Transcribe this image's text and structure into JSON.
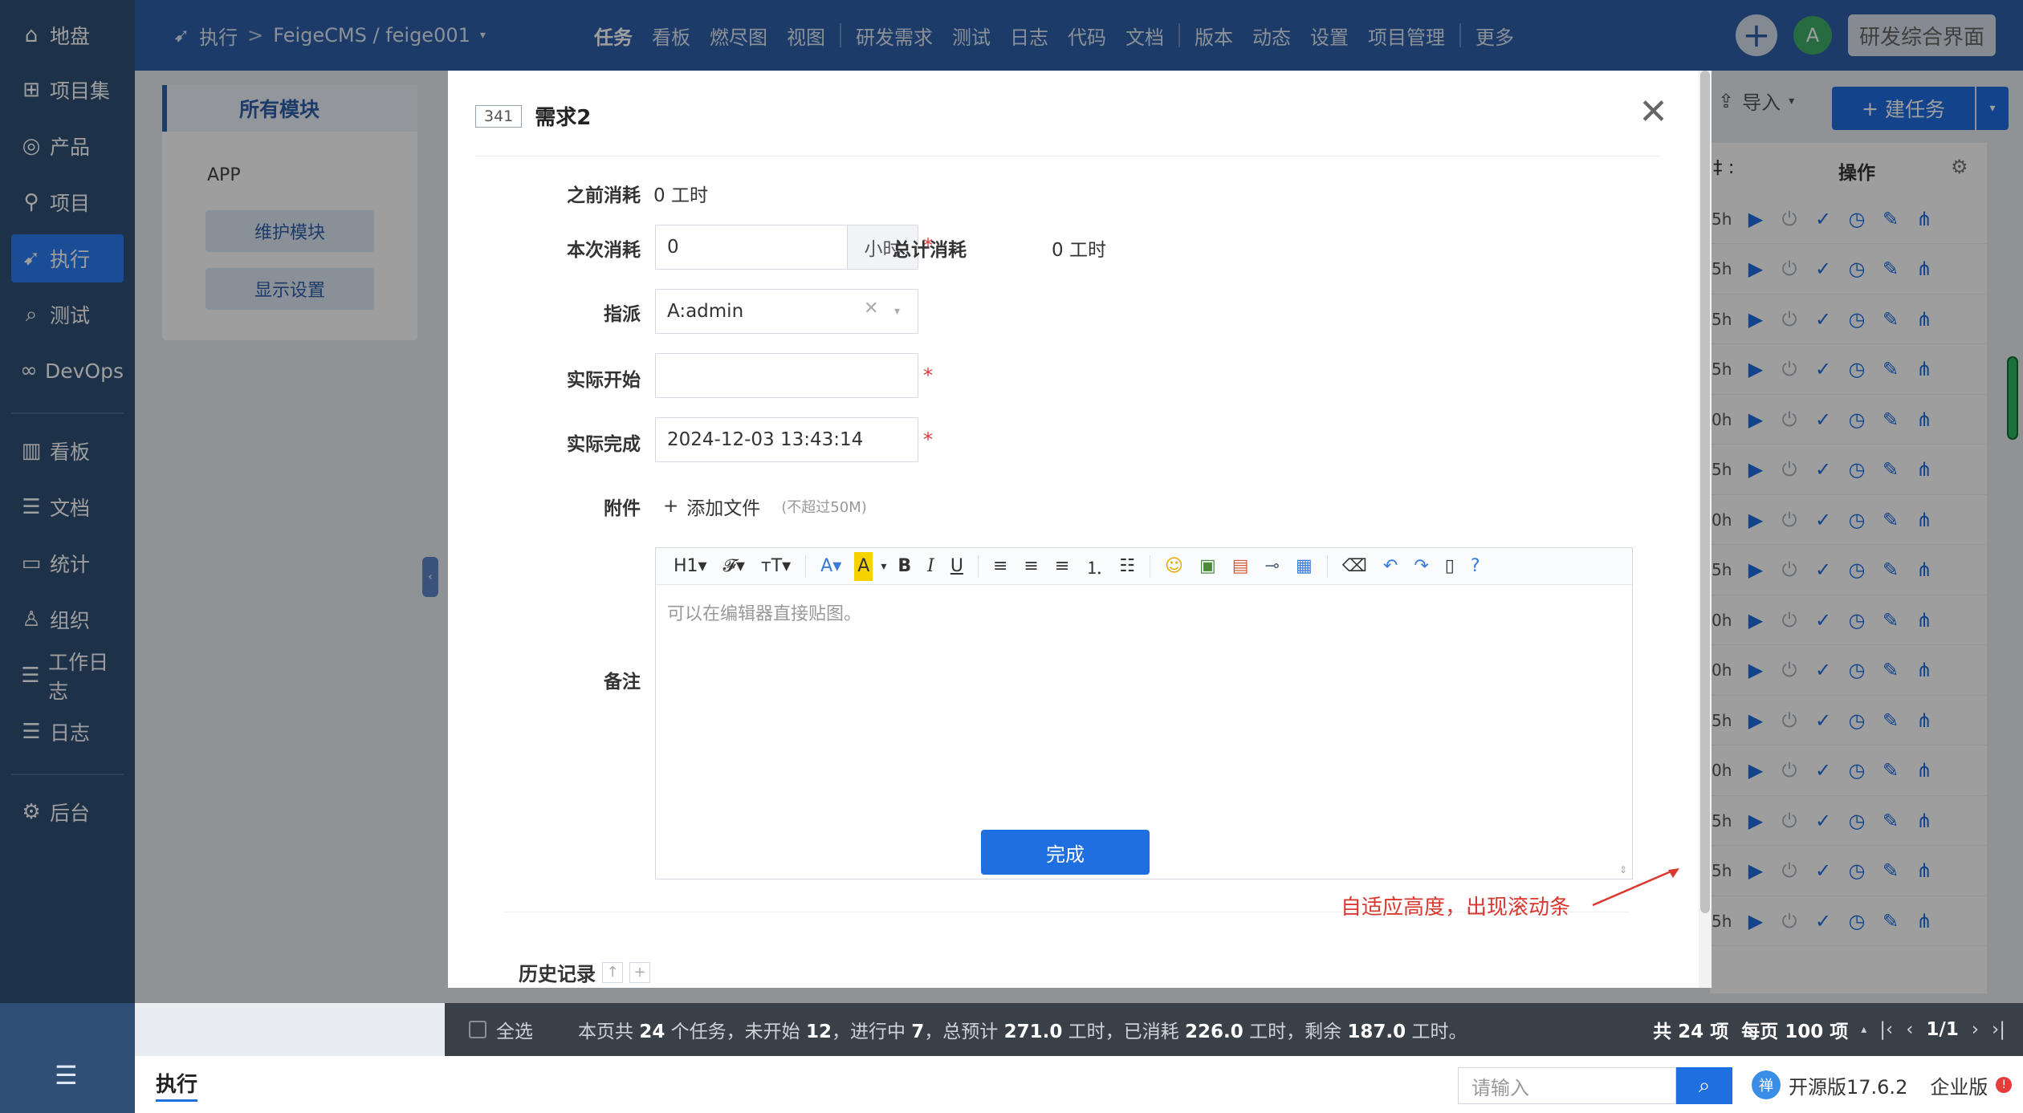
{
  "sidebar": {
    "items": [
      {
        "label": "地盘",
        "icon": "home-icon",
        "glyph": "⌂"
      },
      {
        "label": "项目集",
        "icon": "grid-icon",
        "glyph": "⊞"
      },
      {
        "label": "产品",
        "icon": "lightbulb-icon",
        "glyph": "◎"
      },
      {
        "label": "项目",
        "icon": "rocket-icon",
        "glyph": "⚲"
      },
      {
        "label": "执行",
        "icon": "run-icon",
        "glyph": "➹"
      },
      {
        "label": "测试",
        "icon": "search-bug-icon",
        "glyph": "⌕"
      },
      {
        "label": "DevOps",
        "icon": "infinity-icon",
        "glyph": "∞"
      },
      {
        "label": "看板",
        "icon": "kanban-icon",
        "glyph": "▥"
      },
      {
        "label": "文档",
        "icon": "document-icon",
        "glyph": "☰"
      },
      {
        "label": "统计",
        "icon": "chart-icon",
        "glyph": "▭"
      },
      {
        "label": "组织",
        "icon": "user-icon",
        "glyph": "♙"
      },
      {
        "label": "工作日志",
        "icon": "log-icon",
        "glyph": "☰"
      },
      {
        "label": "日志",
        "icon": "list-icon",
        "glyph": "☰"
      },
      {
        "label": "后台",
        "icon": "gear-icon",
        "glyph": "⚙"
      }
    ],
    "collapse_glyph": "☰"
  },
  "topbar": {
    "section": "执行",
    "sep": ">",
    "project": "FeigeCMS / feige001",
    "nav": [
      "任务",
      "看板",
      "燃尽图",
      "视图",
      "研发需求",
      "测试",
      "日志",
      "代码",
      "文档",
      "版本",
      "动态",
      "设置",
      "项目管理",
      "更多"
    ],
    "avatar": "A",
    "dev_button": "研发综合界面"
  },
  "module": {
    "tab": "所有模块",
    "app": "APP",
    "maintain": "维护模块",
    "display": "显示设置"
  },
  "list": {
    "import": "导入",
    "new_task": "建任务",
    "ops_header": "操作",
    "col_colon": "‡ :",
    "hours": [
      "5h",
      "5h",
      "5h",
      "5h",
      "0h",
      "5h",
      "0h",
      "5h",
      "0h",
      "0h",
      "5h",
      "0h",
      "5h",
      "5h",
      "5h"
    ]
  },
  "status": {
    "select_all": "全选",
    "summary_prefix": "本页共 ",
    "total_tasks": "24",
    "summary_mid1": " 个任务，未开始 ",
    "not_started": "12",
    "summary_mid2": "，进行中 ",
    "in_progress": "7",
    "summary_mid3": "，总预计 ",
    "estimate": "271.0",
    "summary_mid4": " 工时，已消耗 ",
    "consumed": "226.0",
    "summary_mid5": " 工时，剩余 ",
    "remaining": "187.0",
    "summary_end": " 工时。",
    "total_items": "共 24 项",
    "per_page": "每页 100 项",
    "page": "1/1"
  },
  "footer": {
    "crumb": "执行",
    "search_placeholder": "请输入",
    "version": "开源版17.6.2",
    "enterprise": "企业版"
  },
  "modal": {
    "id": "341",
    "title": "需求2",
    "fields": {
      "prev_consumed_label": "之前消耗",
      "prev_consumed_value": "0 工时",
      "this_consumed_label": "本次消耗",
      "this_consumed_value": "0",
      "unit": "小时",
      "total_consumed_label": "总计消耗",
      "total_consumed_value": "0 工时",
      "assign_label": "指派",
      "assign_value": "A:admin",
      "real_start_label": "实际开始",
      "real_start_value": "",
      "real_finish_label": "实际完成",
      "real_finish_value": "2024-12-03 13:43:14",
      "attach_label": "附件",
      "add_file": "添加文件",
      "file_hint": "(不超过50M)",
      "remark_label": "备注",
      "editor_placeholder": "可以在编辑器直接贴图。"
    },
    "done_button": "完成",
    "history": "历史记录"
  },
  "annotation": "自适应高度，出现滚动条",
  "colors": {
    "sidebar": "#2f4f77",
    "topbar": "#2f60a8",
    "primary": "#1f6fe0",
    "required": "#e2383c",
    "annotation": "#d9382f"
  }
}
